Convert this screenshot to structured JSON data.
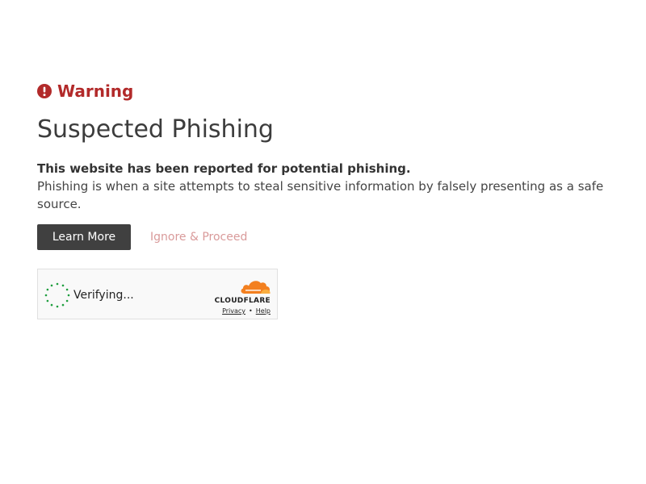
{
  "header": {
    "warning_label": "Warning",
    "warning_icon": "exclamation-circle-icon",
    "warning_color": "#b22a2a"
  },
  "main": {
    "title": "Suspected Phishing",
    "lead": "This website has been reported for potential phishing.",
    "description": "Phishing is when a site attempts to steal sensitive information by falsely presenting as a safe source."
  },
  "actions": {
    "learn_more_label": "Learn More",
    "ignore_label": "Ignore & Proceed"
  },
  "turnstile": {
    "status": "Verifying...",
    "brand": "CLOUDFLARE",
    "privacy_label": "Privacy",
    "separator": "•",
    "help_label": "Help",
    "brand_color": "#f38020",
    "spinner_color": "#1e9e3e"
  }
}
